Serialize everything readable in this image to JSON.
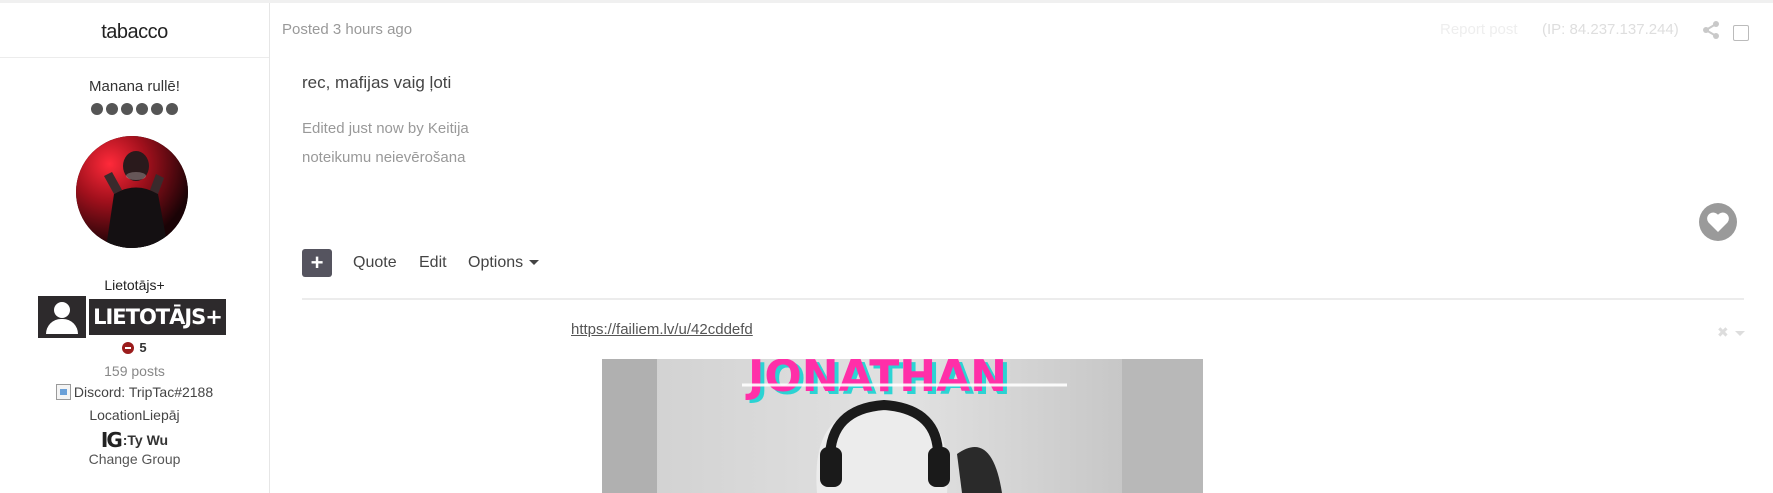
{
  "author": {
    "name": "tabacco",
    "member_title": "Manana rullē!",
    "rank_pips": 6,
    "group_label": "Lietotājs+",
    "group_badge_text": "LIETOTĀJS+",
    "reputation": "5",
    "posts": "159 posts",
    "discord": "Discord: TripTac#2188",
    "location": "LocationLiepāj",
    "instagram_prefix": "IG",
    "instagram": ":Ty Wu",
    "change_group": "Change Group"
  },
  "post": {
    "posted": "Posted 3 hours ago",
    "report": "Report post",
    "ip": "(IP: 84.237.137.244)",
    "text": "rec, mafijas vaig ļoti",
    "edited": "Edited just now by Keitija",
    "edit_reason": "noteikumu neievērošana"
  },
  "actions": {
    "add": "+",
    "quote": "Quote",
    "edit": "Edit",
    "options": "Options"
  },
  "signature": {
    "link": "https://failiem.lv/u/42cddefd",
    "image_caption": "JONATHAN"
  },
  "colors": {
    "button_dark": "#55545f",
    "badge_bg": "#2d2a2c",
    "reputation_negative": "#9b1c1c",
    "muted_text": "#999999",
    "like_grey": "#9a9a9a"
  },
  "icons": {
    "share": "share-icon",
    "like": "heart-icon",
    "user": "user-silhouette-icon",
    "reputation": "minus-circle-icon",
    "signature_menu": "close-icon"
  }
}
